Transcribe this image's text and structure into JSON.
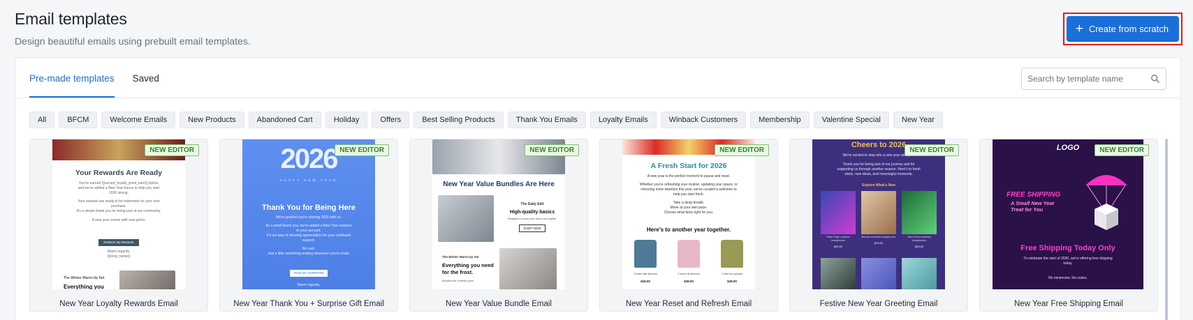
{
  "header": {
    "title": "Email templates",
    "subtitle": "Design beautiful emails using prebuilt email templates."
  },
  "create_button": {
    "icon": "plus-icon",
    "label": "Create from scratch"
  },
  "tabs": [
    {
      "label": "Pre-made templates",
      "active": true
    },
    {
      "label": "Saved",
      "active": false
    }
  ],
  "search": {
    "placeholder": "Search by template name",
    "icon": "search-icon"
  },
  "categories": [
    "All",
    "BFCM",
    "Welcome Emails",
    "New Products",
    "Abandoned Cart",
    "Holiday",
    "Offers",
    "Best Selling Products",
    "Thank You Emails",
    "Loyalty Emails",
    "Winback Customers",
    "Membership",
    "Valentine Special",
    "New Year"
  ],
  "badge_label": "NEW EDITOR",
  "templates": [
    {
      "name": "New Year Loyalty Rewards Email",
      "preview": {
        "headline": "Your Rewards Are Ready",
        "body": [
          "You've earned {{current_loyalty_point_earn}} points,",
          "and we've added a New Year bonus to help you start",
          "2026 strong.",
          "Your rewards are ready to be redeemed on your next",
          "purchase.",
          "It's a simple thank you for being part of our community.",
          "A new year comes with new perks."
        ],
        "button": "Redeem My Rewards",
        "signoff": [
          "Warm regards,",
          "{{shop_name}}"
        ],
        "section_label": "The Winter Warm-Up Set",
        "section_title": "Everything you"
      }
    },
    {
      "name": "New Year Thank You + Surprise Gift Email",
      "preview": {
        "year": "2026",
        "year_caption": "HAPPY NEW YEAR",
        "headline": "Thank You for Being Here",
        "body": [
          "We're grateful you're starting 2026 with us.",
          "As a small thank you, we've added a New Year surprise",
          "to your account.",
          "It's our way of showing appreciation for your continued",
          "support.",
          "No rush.",
          "Just a little something waiting whenever you're ready."
        ],
        "button": "VIEW MY SURPRISE",
        "footer": "Warm regards,"
      }
    },
    {
      "name": "New Year Value Bundle Email",
      "preview": {
        "headline": "New Year Value Bundles Are Here",
        "bundle_label": "The Daily Edit",
        "bundle_title": "High-quality basics",
        "bundle_desc": "Designed to keep you warm and stylish.",
        "button": "SHOP NOW",
        "section_label": "The Winter Warm-Up Set",
        "section_title": "Everything you need for the frost.",
        "section_desc": "Bundled for a better price."
      }
    },
    {
      "name": "New Year Reset and Refresh Email",
      "preview": {
        "headline": "A Fresh Start for 2026",
        "body": [
          "A new year is the perfect moment to pause and reset.",
          "Whether you're refreshing your routine, updating your space, or",
          "choosing more intention this year, we've curated a selection to",
          "help you start fresh.",
          "Take a deep breath.",
          "Move at your own pace.",
          "Choose what feels right for you."
        ],
        "subheadline": "Here's to another year together.",
        "products": [
          {
            "name": "T-shirt Half sleeves",
            "price": "$18.00"
          },
          {
            "name": "T-shirt full sleeves",
            "price": "$28.00"
          },
          {
            "name": "T-shirt for women",
            "price": "$28.00"
          }
        ]
      }
    },
    {
      "name": "Festive New Year Greeting Email",
      "preview": {
        "headline": "Cheers to 2026",
        "body": [
          "We're excited to step into a new year with you.",
          "Thank you for being part of our journey and for",
          "supporting us through another season. Here's to fresh",
          "starts, new ideas, and meaningful moments."
        ],
        "section": "Explore What's New",
        "products": [
          {
            "name": "Flash Pulse cordless headphones",
            "price": "$29.00"
          },
          {
            "name": "Bronze overhead headphones",
            "price": "$19.00"
          },
          {
            "name": "Neon Green wireless headphones",
            "price": "$28.00"
          }
        ]
      }
    },
    {
      "name": "New Year Free Shipping Email",
      "preview": {
        "logo": "LOGO",
        "hero_title": "FREE SHIPPING",
        "hero_sub": [
          "A Small New Year",
          "Treat for You"
        ],
        "headline": "Free Shipping Today Only",
        "body": [
          "To celebrate the start of 2026, we're offering free shipping",
          "today."
        ],
        "footer": "No minimums. No codes."
      }
    }
  ]
}
